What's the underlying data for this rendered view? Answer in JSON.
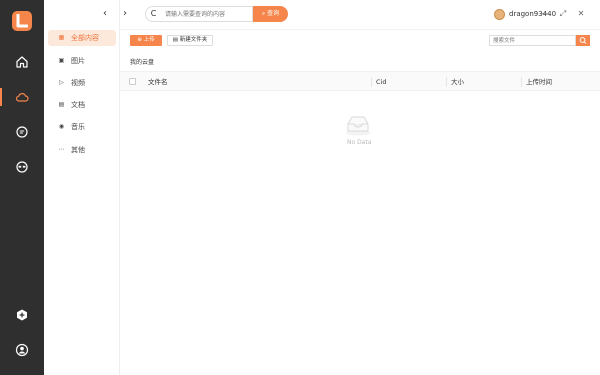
{
  "nav": {
    "back": "‹",
    "forward": "›",
    "refresh": "C",
    "search_placeholder": "请输入需要查询的内容",
    "search_button": "查询"
  },
  "user": {
    "name": "dragon93440"
  },
  "window_controls": {
    "minimize": "—",
    "maximize": "⤢",
    "close": "✕"
  },
  "categories": [
    {
      "label": "全部内容",
      "active": true
    },
    {
      "label": "图片"
    },
    {
      "label": "视频"
    },
    {
      "label": "文档"
    },
    {
      "label": "音乐"
    },
    {
      "label": "其他"
    }
  ],
  "toolbar": {
    "upload_label": "上传",
    "new_folder_label": "新建文件夹",
    "file_search_placeholder": "搜索文件"
  },
  "breadcrumb": "我的云盘",
  "table": {
    "columns": [
      "文件名",
      "Cid",
      "大小",
      "上传时间"
    ],
    "empty_text": "No Data"
  },
  "colors": {
    "accent": "#f5854a",
    "rail": "#2f2f2f",
    "active_bg": "#fde8dc"
  }
}
